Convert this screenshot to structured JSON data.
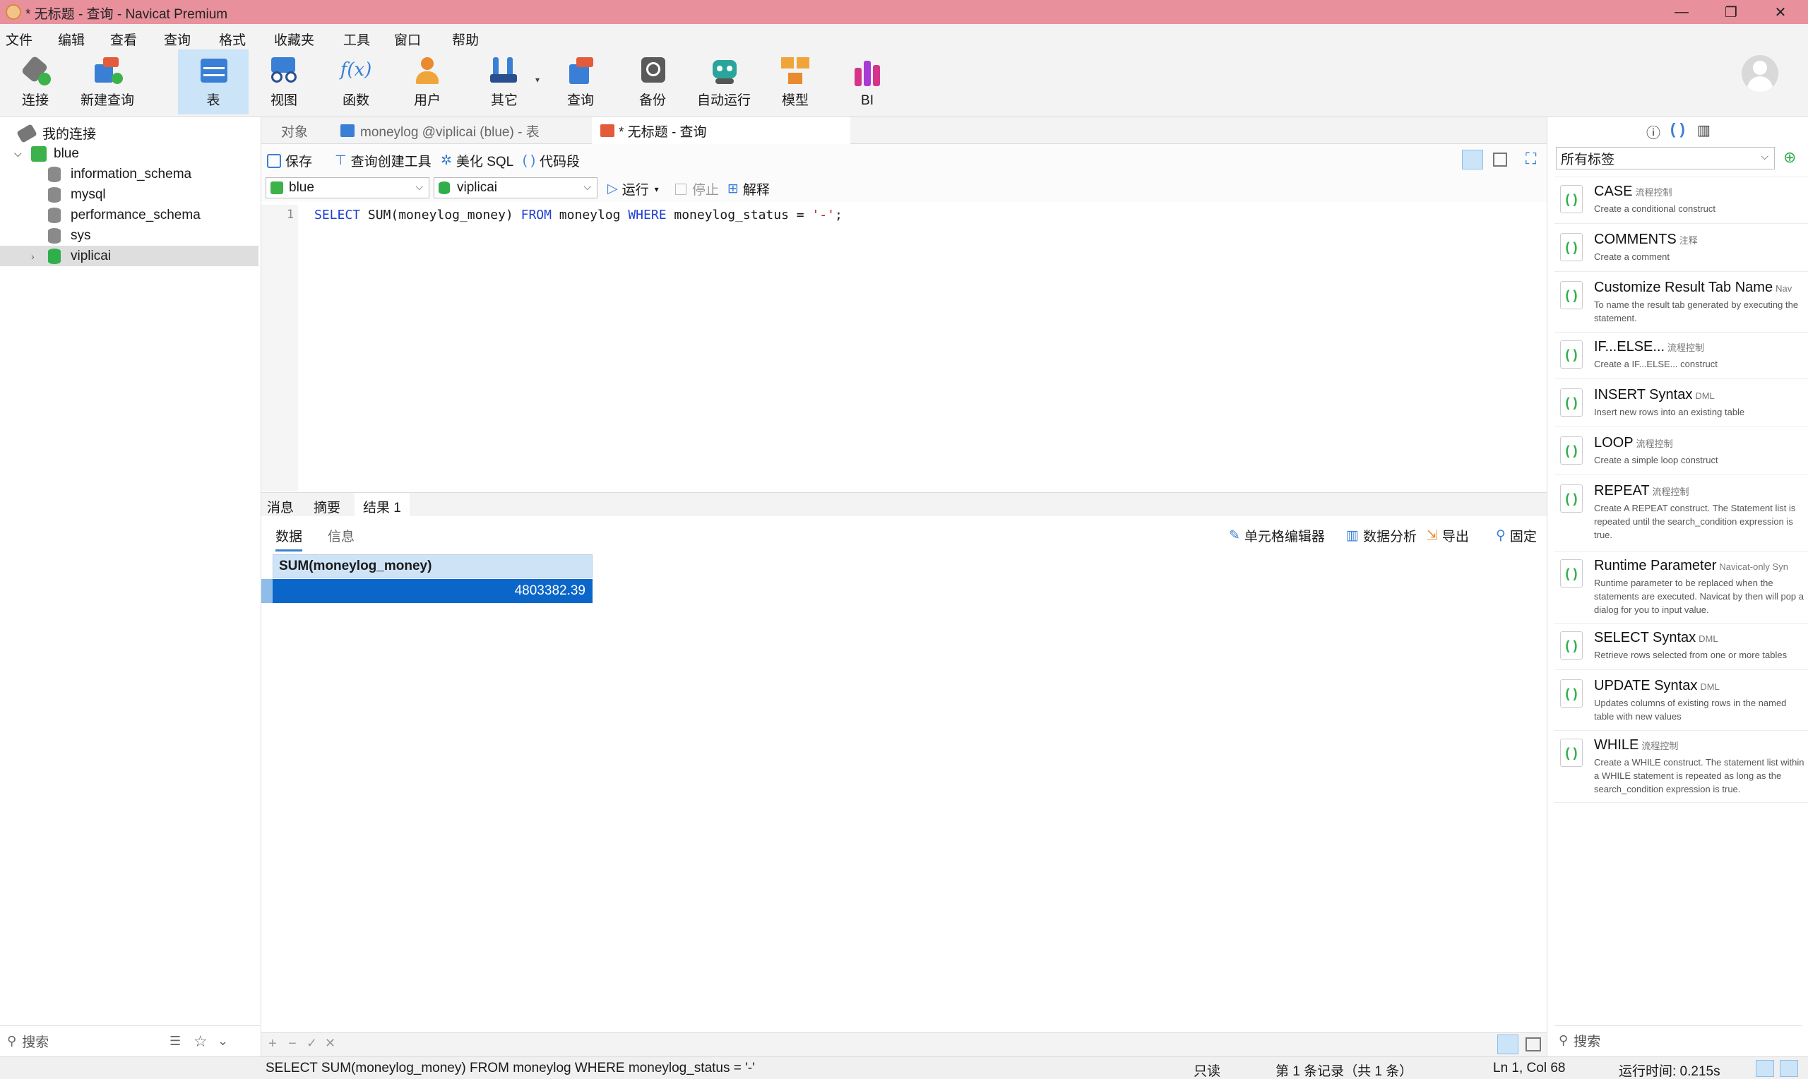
{
  "window": {
    "title": "* 无标题 - 查询 - Navicat Premium",
    "minimize": "—",
    "maximize": "❐",
    "close": "✕"
  },
  "menu": [
    "文件",
    "编辑",
    "查看",
    "查询",
    "格式",
    "收藏夹",
    "工具",
    "窗口",
    "帮助"
  ],
  "toolbar": [
    "连接",
    "新建查询",
    "表",
    "视图",
    "函数",
    "用户",
    "其它",
    "查询",
    "备份",
    "自动运行",
    "模型",
    "BI"
  ],
  "toolbar_icons": {
    "function": "f(x)",
    "bi": "BI"
  },
  "nav": {
    "root": "我的连接",
    "connection": "blue",
    "databases": [
      "information_schema",
      "mysql",
      "performance_schema",
      "sys",
      "viplicai"
    ],
    "search_placeholder": "搜索"
  },
  "tabs": {
    "objects": "对象",
    "table_tab": "moneylog @viplicai (blue) - 表",
    "query_tab": "* 无标题 - 查询"
  },
  "query_toolbar": {
    "save": "保存",
    "builder": "查询创建工具",
    "beautify": "美化 SQL",
    "snippet": "代码段",
    "run": "运行",
    "stop": "停止",
    "explain": "解释"
  },
  "selectors": {
    "connection": "blue",
    "database": "viplicai"
  },
  "editor": {
    "line_number": "1",
    "sql_parts": [
      "SELECT",
      " SUM(moneylog_money) ",
      "FROM",
      " moneylog ",
      "WHERE",
      " moneylog_status = ",
      "'-'",
      ";"
    ]
  },
  "result_tabs": [
    "消息",
    "摘要",
    "结果 1"
  ],
  "result_subtabs": [
    "数据",
    "信息"
  ],
  "result_tools": {
    "cell_editor": "单元格编辑器",
    "analysis": "数据分析",
    "export": "导出",
    "pin": "固定"
  },
  "grid": {
    "columns": [
      "SUM(moneylog_money)"
    ],
    "rows": [
      [
        "4803382.39"
      ]
    ]
  },
  "right_panel": {
    "tag_filter": "所有标签",
    "search_placeholder": "搜索",
    "snippets": [
      {
        "title": "CASE",
        "tag": "流程控制",
        "desc": "Create a conditional construct"
      },
      {
        "title": "COMMENTS",
        "tag": "注释",
        "desc": "Create a comment"
      },
      {
        "title": "Customize Result Tab Name",
        "tag": "Nav",
        "desc": "To name the result tab generated by executing the statement."
      },
      {
        "title": "IF...ELSE...",
        "tag": "流程控制",
        "desc": "Create a IF...ELSE... construct"
      },
      {
        "title": "INSERT Syntax",
        "tag": "DML",
        "desc": "Insert new rows into an existing table"
      },
      {
        "title": "LOOP",
        "tag": "流程控制",
        "desc": "Create a simple loop construct"
      },
      {
        "title": "REPEAT",
        "tag": "流程控制",
        "desc": "Create A REPEAT construct. The Statement list is repeated until the search_condition expression is true."
      },
      {
        "title": "Runtime Parameter",
        "tag": "Navicat-only Syn",
        "desc": "Runtime parameter to be replaced when the statements are executed. Navicat by then will pop a dialog for you to input value."
      },
      {
        "title": "SELECT Syntax",
        "tag": "DML",
        "desc": "Retrieve rows selected from one or more tables"
      },
      {
        "title": "UPDATE Syntax",
        "tag": "DML",
        "desc": "Updates columns of existing rows in the named table with new values"
      },
      {
        "title": "WHILE",
        "tag": "流程控制",
        "desc": "Create a WHILE construct. The statement list within a WHILE statement is repeated as long as the search_condition expression is true."
      }
    ]
  },
  "status": {
    "sql": "SELECT SUM(moneylog_money) FROM moneylog WHERE moneylog_status = '-'",
    "readonly": "只读",
    "records": "第 1 条记录（共 1 条）",
    "position": "Ln 1, Col 68",
    "runtime": "运行时间: 0.215s"
  },
  "colors": {
    "titlebar": "#e9909d",
    "selection": "#0b66c9",
    "active_tool": "#cce4f7",
    "grid_header": "#cfe3f7",
    "keyword": "#1f3fd1",
    "string": "#b01d1d",
    "snippet_icon": "#2fae49"
  }
}
